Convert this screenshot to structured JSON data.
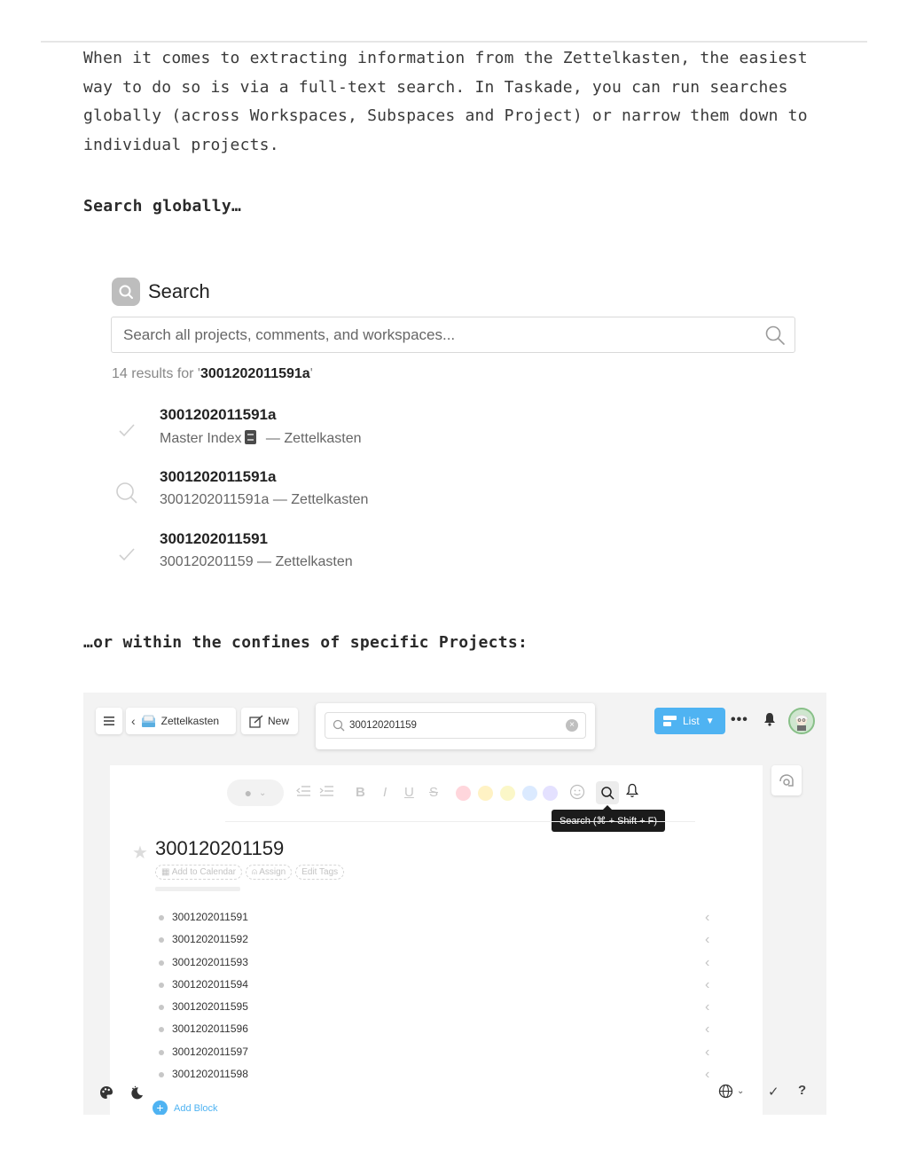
{
  "intro": {
    "paragraph": "When it comes to extracting information from the Zettelkasten, the easiest way to do so is via a full-text search. In Taskade, you can run searches globally (across Workspaces, Subspaces and Project) or narrow them down to individual projects."
  },
  "headings": {
    "global": "Search globally…",
    "project": "…or within the confines of specific Projects:"
  },
  "global_search": {
    "title": "Search",
    "placeholder": "Search all projects, comments, and workspaces...",
    "results_prefix": "14 results for '",
    "results_query": "3001202011591a",
    "results_suffix": "'",
    "results": [
      {
        "icon": "check-icon",
        "title": "3001202011591a",
        "path_start": "Master Index",
        "path_end": " — Zettelkasten"
      },
      {
        "icon": "search-icon",
        "title": "3001202011591a",
        "path": "3001202011591a — Zettelkasten"
      },
      {
        "icon": "check-icon",
        "title": "3001202011591",
        "path": "300120201159 — Zettelkasten"
      }
    ]
  },
  "project_view": {
    "header": {
      "workspace": "Zettelkasten",
      "new_label": "New",
      "search_value": "300120201159",
      "view_label": "List"
    },
    "toolbar": {
      "bold": "B",
      "italic": "I",
      "underline": "U",
      "strike": "S",
      "colors": [
        "#ffd6dc",
        "#fff2c4",
        "#fbf7c8",
        "#dbeaff",
        "#e4e1ff"
      ],
      "tooltip": "Search (⌘ + Shift + F)"
    },
    "title": "300120201159",
    "chips": [
      "Add to Calendar",
      "Assign",
      "Edit Tags"
    ],
    "items": [
      "3001202011591",
      "3001202011592",
      "3001202011593",
      "3001202011594",
      "3001202011595",
      "3001202011596",
      "3001202011597",
      "3001202011598"
    ],
    "add_block": "Add Block",
    "footer": {
      "help": "?"
    }
  }
}
